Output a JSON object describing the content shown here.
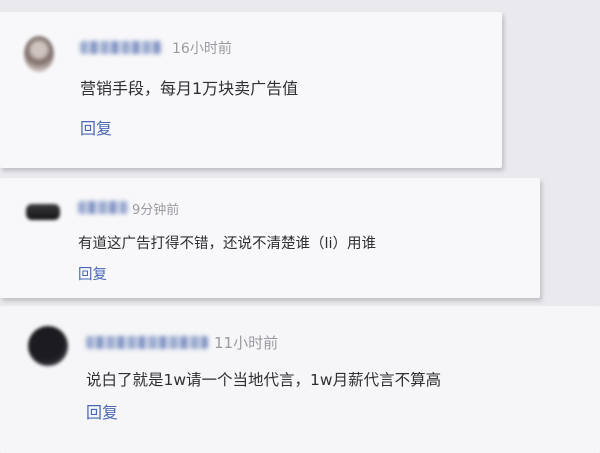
{
  "comments": [
    {
      "time": "16小时前",
      "text": "营销手段，每月1万块卖广告值",
      "reply_label": "回复"
    },
    {
      "time": "9分钟前",
      "text": "有道这广告打得不错，还说不清楚谁（li）用谁",
      "reply_label": "回复"
    },
    {
      "time": "11小时前",
      "text": "说白了就是1w请一个当地代言，1w月薪代言不算高",
      "reply_label": "回复"
    }
  ]
}
